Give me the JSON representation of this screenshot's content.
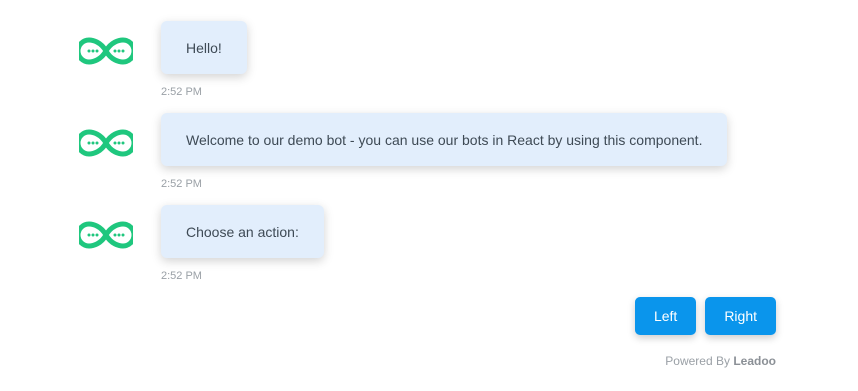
{
  "colors": {
    "bubble_bg": "#e2eefc",
    "avatar_green": "#1fc77e",
    "button_blue": "#0a95ec"
  },
  "avatar_icon": "infinity-chat-icon",
  "messages": [
    {
      "text": "Hello!",
      "time": "2:52 PM"
    },
    {
      "text": "Welcome to our demo bot - you can use our bots in React by using this component.",
      "time": "2:52 PM"
    },
    {
      "text": "Choose an action:",
      "time": "2:52 PM"
    }
  ],
  "actions": [
    {
      "label": "Left"
    },
    {
      "label": "Right"
    }
  ],
  "footer": {
    "powered_by": "Powered By",
    "brand": "Leadoo"
  }
}
